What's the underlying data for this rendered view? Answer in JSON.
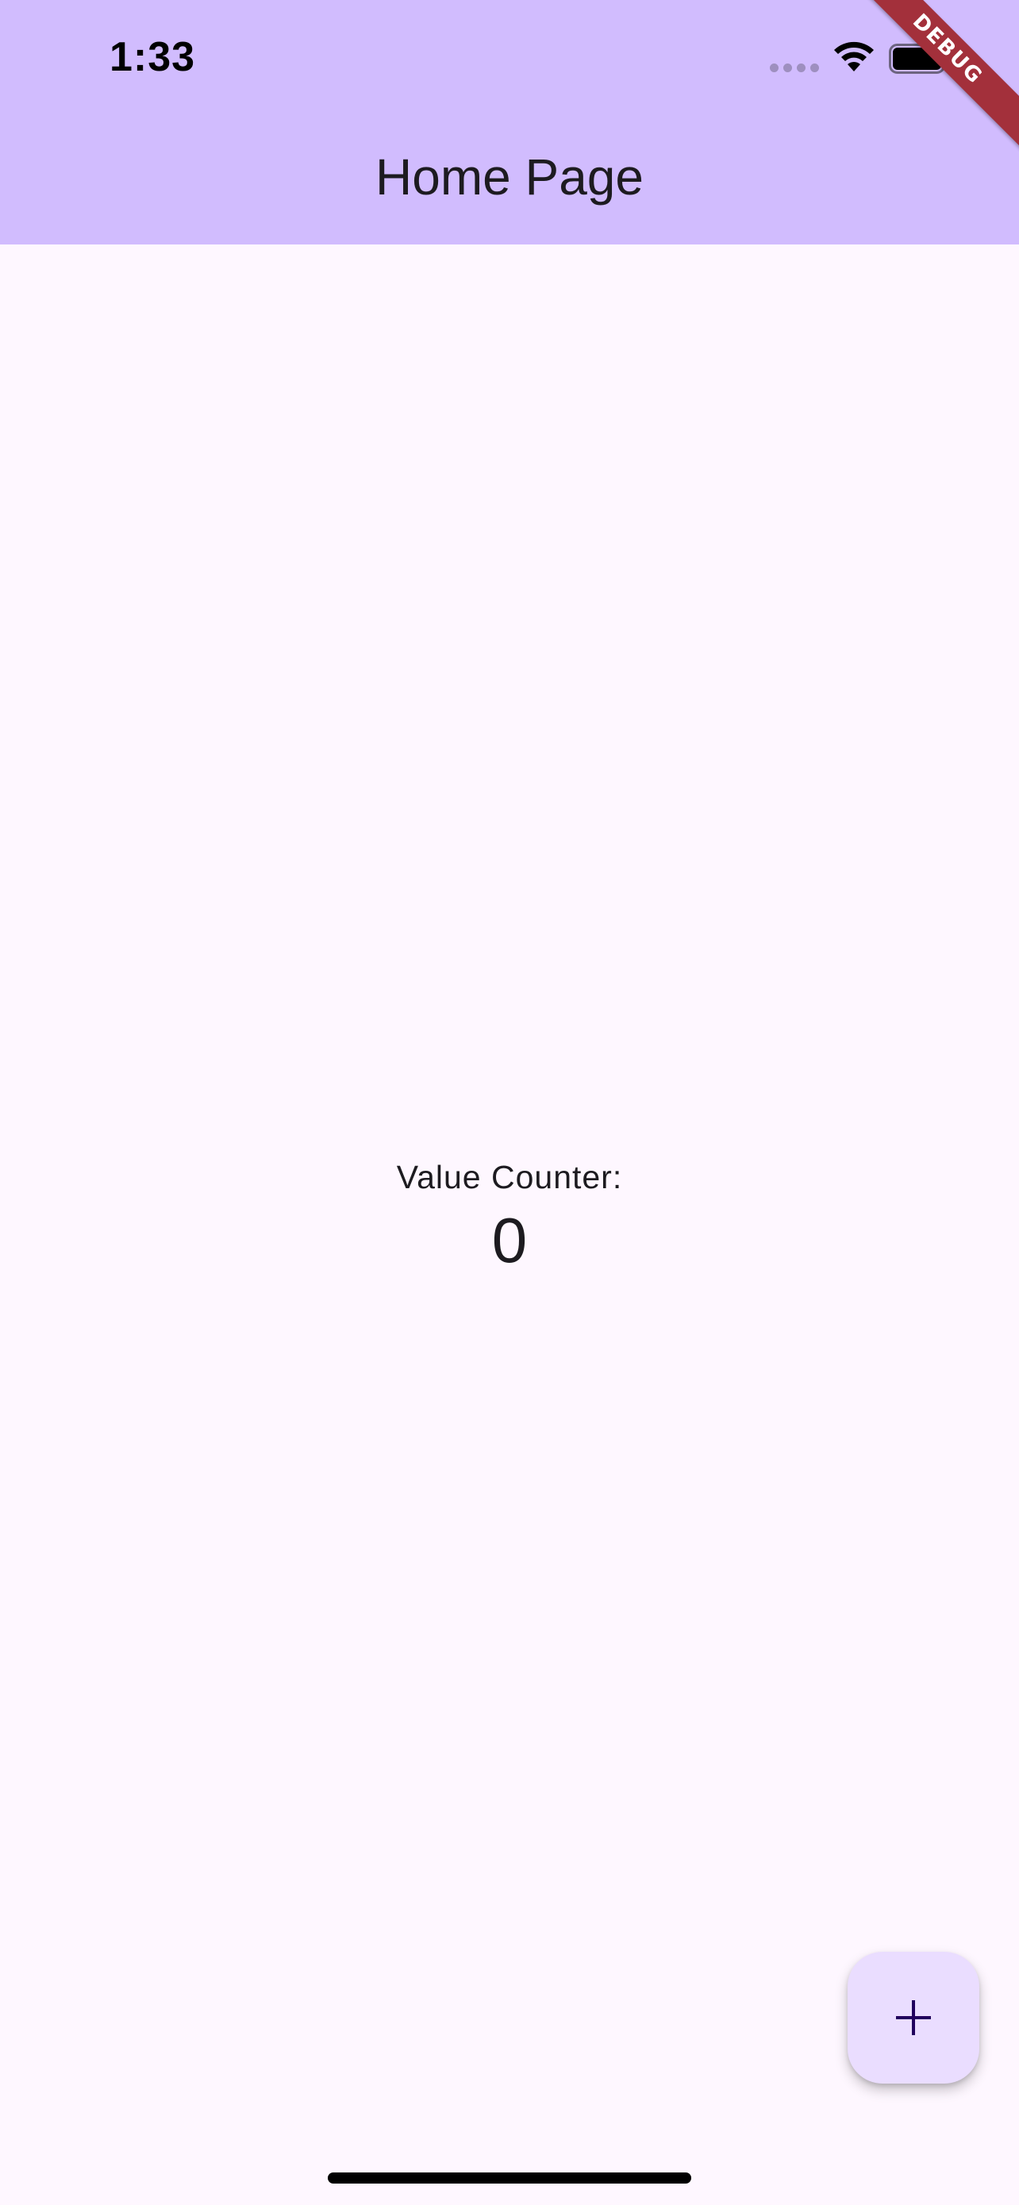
{
  "status_bar": {
    "time": "1:33",
    "icons": [
      "signal-icon",
      "wifi-icon",
      "battery-icon"
    ]
  },
  "debug_banner": {
    "label": "DEBUG"
  },
  "app_bar": {
    "title": "Home Page"
  },
  "main": {
    "counter_label": "Value Counter:",
    "counter_value": "0"
  },
  "fab": {
    "icon": "add-icon"
  },
  "colors": {
    "app_bar_bg": "#d1bcfe",
    "page_bg": "#fef7ff",
    "fab_bg": "#eaddff",
    "fab_icon": "#21005d",
    "debug_banner": "#a3303b",
    "text": "#1d1b20"
  }
}
